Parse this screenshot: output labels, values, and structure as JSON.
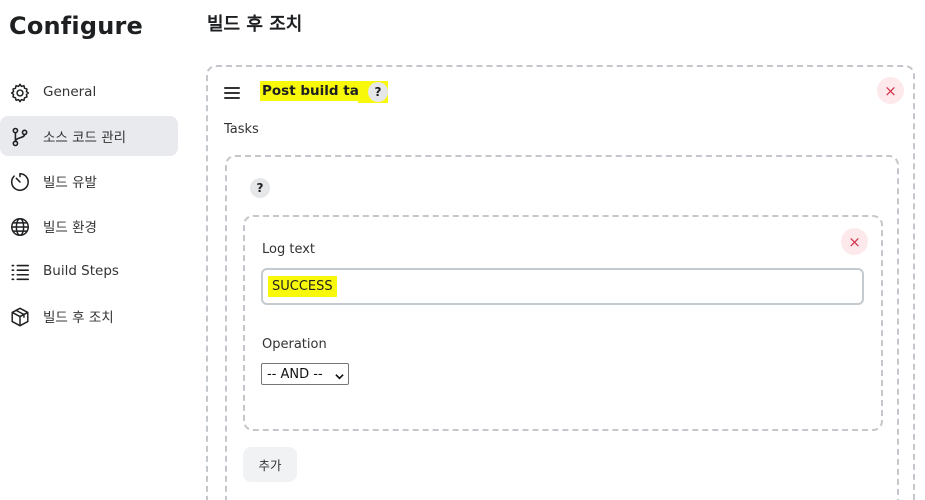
{
  "sidebar": {
    "title": "Configure",
    "items": [
      {
        "label": "General",
        "icon": "gear-icon"
      },
      {
        "label": "소스 코드 관리",
        "icon": "branch-icon",
        "active": true
      },
      {
        "label": "빌드 유발",
        "icon": "timer-icon"
      },
      {
        "label": "빌드 환경",
        "icon": "globe-icon"
      },
      {
        "label": "Build Steps",
        "icon": "list-icon"
      },
      {
        "label": "빌드 후 조치",
        "icon": "package-icon"
      }
    ]
  },
  "main": {
    "heading": "빌드 후 조치",
    "post_build_task": {
      "title": "Post build task",
      "help": "?",
      "close": "×",
      "tasks_label": "Tasks",
      "tasks_help": "?",
      "task": {
        "close": "×",
        "log_text_label": "Log text",
        "log_text_value": "SUCCESS",
        "operation_label": "Operation",
        "operation_selected": "-- AND --"
      },
      "add_button": "추가"
    }
  },
  "colors": {
    "highlight": "#f8f80b",
    "active_nav_bg": "#e8eaee",
    "close_bg": "#fde9ec",
    "close_fg": "#d1344c"
  }
}
